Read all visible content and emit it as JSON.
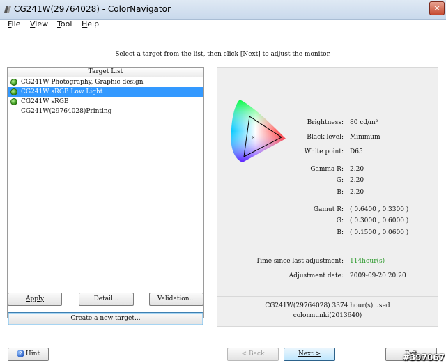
{
  "window": {
    "title": "CG241W(29764028) - ColorNavigator",
    "close_glyph": "✕"
  },
  "menu": {
    "items": [
      "File",
      "View",
      "Tool",
      "Help"
    ]
  },
  "instruction": "Select a target from the list, then click [Next] to adjust the monitor.",
  "target_list": {
    "header": "Target List",
    "rows": [
      {
        "label": "CG241W Photography, Graphic design",
        "has_status_icon": true,
        "selected": false
      },
      {
        "label": "CG241W sRGB Low Light",
        "has_status_icon": true,
        "selected": true
      },
      {
        "label": "CG241W sRGB",
        "has_status_icon": true,
        "selected": false
      },
      {
        "label": "CG241W(29764028)Printing",
        "has_status_icon": false,
        "selected": false
      }
    ]
  },
  "buttons": {
    "apply": "Apply",
    "detail": "Detail...",
    "validation": "Validation...",
    "create_target": "Create a new target...",
    "hint": "Hint",
    "back": "< Back",
    "next": "Next >",
    "exit": "Exit"
  },
  "details": {
    "brightness_label": "Brightness:",
    "brightness_value": "80 cd/m²",
    "black_level_label": "Black level:",
    "black_level_value": "Minimum",
    "white_point_label": "White point:",
    "white_point_value": "D65",
    "gamma_r_label": "Gamma R:",
    "gamma_r_value": "2.20",
    "gamma_g_label": "G:",
    "gamma_g_value": "2.20",
    "gamma_b_label": "B:",
    "gamma_b_value": "2.20",
    "gamut_r_label": "Gamut R:",
    "gamut_r_value": "( 0.6400 , 0.3300 )",
    "gamut_g_label": "G:",
    "gamut_g_value": "( 0.3000 , 0.6000 )",
    "gamut_b_label": "B:",
    "gamut_b_value": "( 0.1500 , 0.0600 )",
    "time_label": "Time since last adjustment:",
    "time_value": "114hour(s)",
    "date_label": "Adjustment date:",
    "date_value": "2009-09-20 20:20"
  },
  "status": {
    "line1": "CG241W(29764028) 3374 hour(s) used",
    "line2": "colormunki(2013640)"
  },
  "watermark": "#397067",
  "colors": {
    "selection": "#3399ff",
    "time_highlight": "#2d9a2d",
    "panel_bg": "#efefef"
  }
}
